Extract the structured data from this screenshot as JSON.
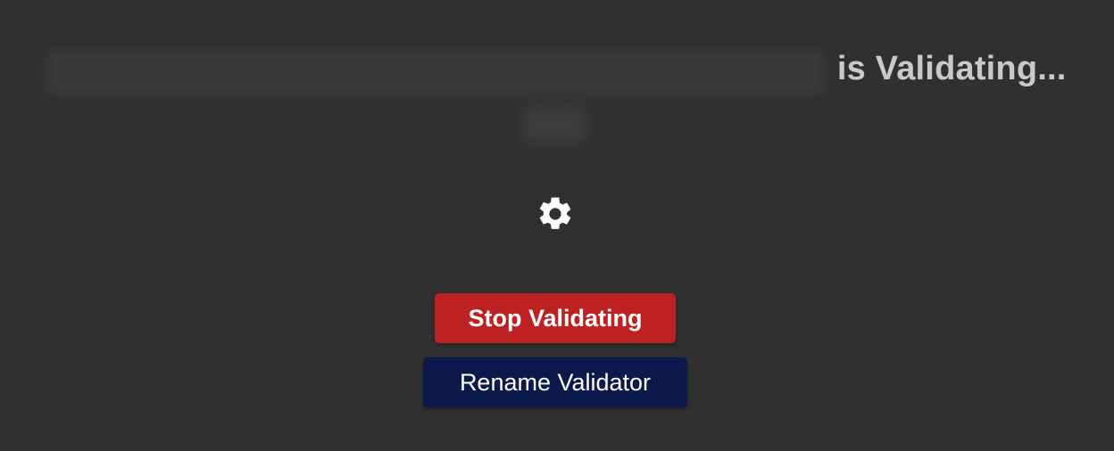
{
  "status": {
    "validator_name_redacted": true,
    "suffix_text": "is Validating..."
  },
  "icons": {
    "activity": "gear-icon"
  },
  "actions": {
    "stop_label": "Stop Validating",
    "rename_label": "Rename Validator"
  },
  "colors": {
    "background": "#303030",
    "stop_button": "#BD2121",
    "rename_button": "#0B1A4A",
    "status_text": "#C9C9C9",
    "icon": "#FFFFFF"
  }
}
